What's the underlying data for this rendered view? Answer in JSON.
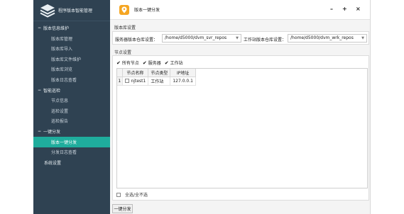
{
  "app": {
    "title": "程序版本智能管理",
    "logo_icon": "layers-icon"
  },
  "sidebar": {
    "groups": [
      {
        "label": "版本信息维护",
        "expanded": true,
        "items": [
          "版本库管理",
          "版本库导入",
          "版本库文件维护",
          "版本库浏览",
          "版本日志查看"
        ]
      },
      {
        "label": "智能巡检",
        "expanded": true,
        "items": [
          "节点信息",
          "巡检设置",
          "巡检报告"
        ]
      },
      {
        "label": "一键分发",
        "expanded": true,
        "items": [
          "版本一键分发",
          "分发日志查看"
        ]
      }
    ],
    "active_item": "版本一键分发",
    "extra_item": "系统设置"
  },
  "window": {
    "title": "版本一键分发",
    "tab_icon": "location-pin-icon",
    "controls": {
      "minimize": "–",
      "maximize": "+",
      "close": "×"
    }
  },
  "repo_settings": {
    "section_label": "版本库设置",
    "server_label": "服务器版本仓库设置：",
    "server_value": "/home/d5000/dvm_svr_repos",
    "workstation_label": "工作站版本仓库设置：",
    "workstation_value": "/home/d5000/dvm_wrk_repos"
  },
  "node_settings": {
    "section_label": "节点设置",
    "filters": [
      {
        "label": "所有节点",
        "checked": true
      },
      {
        "label": "服务器",
        "checked": true
      },
      {
        "label": "工作站",
        "checked": true
      }
    ],
    "columns": [
      "节点名称",
      "节点类型",
      "IP地址"
    ],
    "rows": [
      {
        "num": "1",
        "name": "njtest1",
        "type": "工作站",
        "ip": "127.0.0.1",
        "checked": false
      }
    ],
    "select_all_label": "全选/全不选"
  },
  "action_button": "一键分发",
  "colors": {
    "sidebar_bg": "#2f4252",
    "active_item_bg": "#1fad9d",
    "tab_icon_bg": "#f5a623"
  }
}
